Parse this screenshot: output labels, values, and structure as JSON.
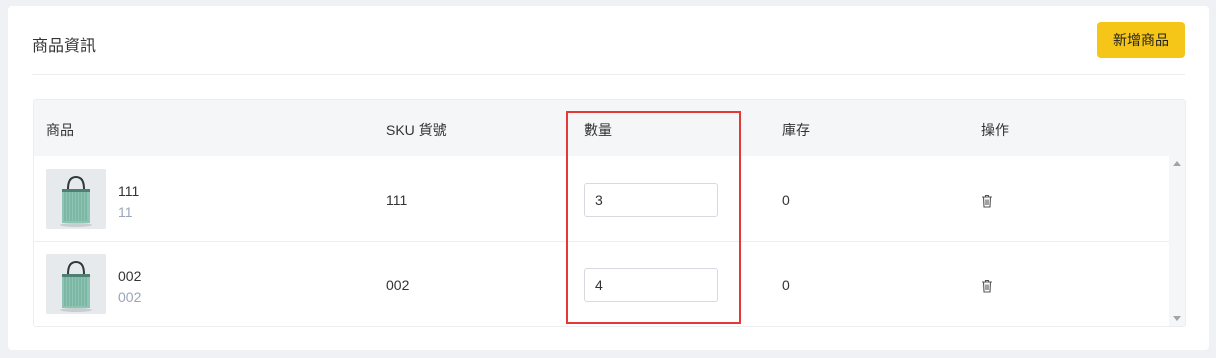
{
  "card": {
    "title": "商品資訊",
    "add_button_label": "新增商品"
  },
  "table": {
    "columns": [
      "商品",
      "SKU 貨號",
      "數量",
      "庫存",
      "操作"
    ],
    "rows": [
      {
        "name": "111",
        "sub": "11",
        "sku": "111",
        "quantity": "3",
        "stock": "0",
        "action_icon": "trash-icon"
      },
      {
        "name": "002",
        "sub": "002",
        "sku": "002",
        "quantity": "4",
        "stock": "0",
        "action_icon": "trash-icon"
      }
    ]
  },
  "colors": {
    "accent": "#f5c518",
    "highlight": "#e53935",
    "muted_text": "#9aa6b8"
  }
}
